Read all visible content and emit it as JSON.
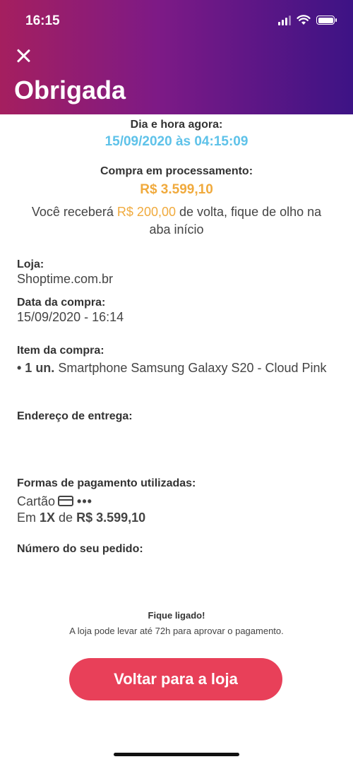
{
  "status_bar": {
    "time": "16:15"
  },
  "header": {
    "title": "Obrigada"
  },
  "summary": {
    "datetime_label": "Dia e hora agora:",
    "datetime_value": "15/09/2020 às 04:15:09",
    "status_label": "Compra em processamento:",
    "total": "R$ 3.599,10",
    "cashback_prefix": "Você receberá ",
    "cashback_amount": "R$ 200,00",
    "cashback_suffix": " de volta, fique de olho na aba início"
  },
  "details": {
    "store_label": "Loja:",
    "store_value": "Shoptime.com.br",
    "date_label": "Data da compra:",
    "date_value": "15/09/2020 - 16:14",
    "item_label": "Item da compra:",
    "item_qty": "• 1 un.",
    "item_name": " Smartphone Samsung Galaxy S20 - Cloud Pink",
    "address_label": "Endereço de entrega:",
    "payment_label": "Formas de pagamento utilizadas:",
    "payment_method": "Cartão",
    "payment_masked": "•••",
    "installments_prefix": "Em ",
    "installments_count": "1X",
    "installments_mid": " de ",
    "installments_value": "R$ 3.599,10",
    "order_label": "Número do seu pedido:"
  },
  "notice": {
    "title": "Fique ligado!",
    "text": "A loja pode levar até 72h para aprovar o pagamento."
  },
  "cta": {
    "label": "Voltar para a loja"
  },
  "colors": {
    "accent": "#e84059",
    "datetime": "#5ec2e9",
    "price": "#f0aa3d",
    "header_start": "#a51f5f",
    "header_end": "#3d1385"
  }
}
